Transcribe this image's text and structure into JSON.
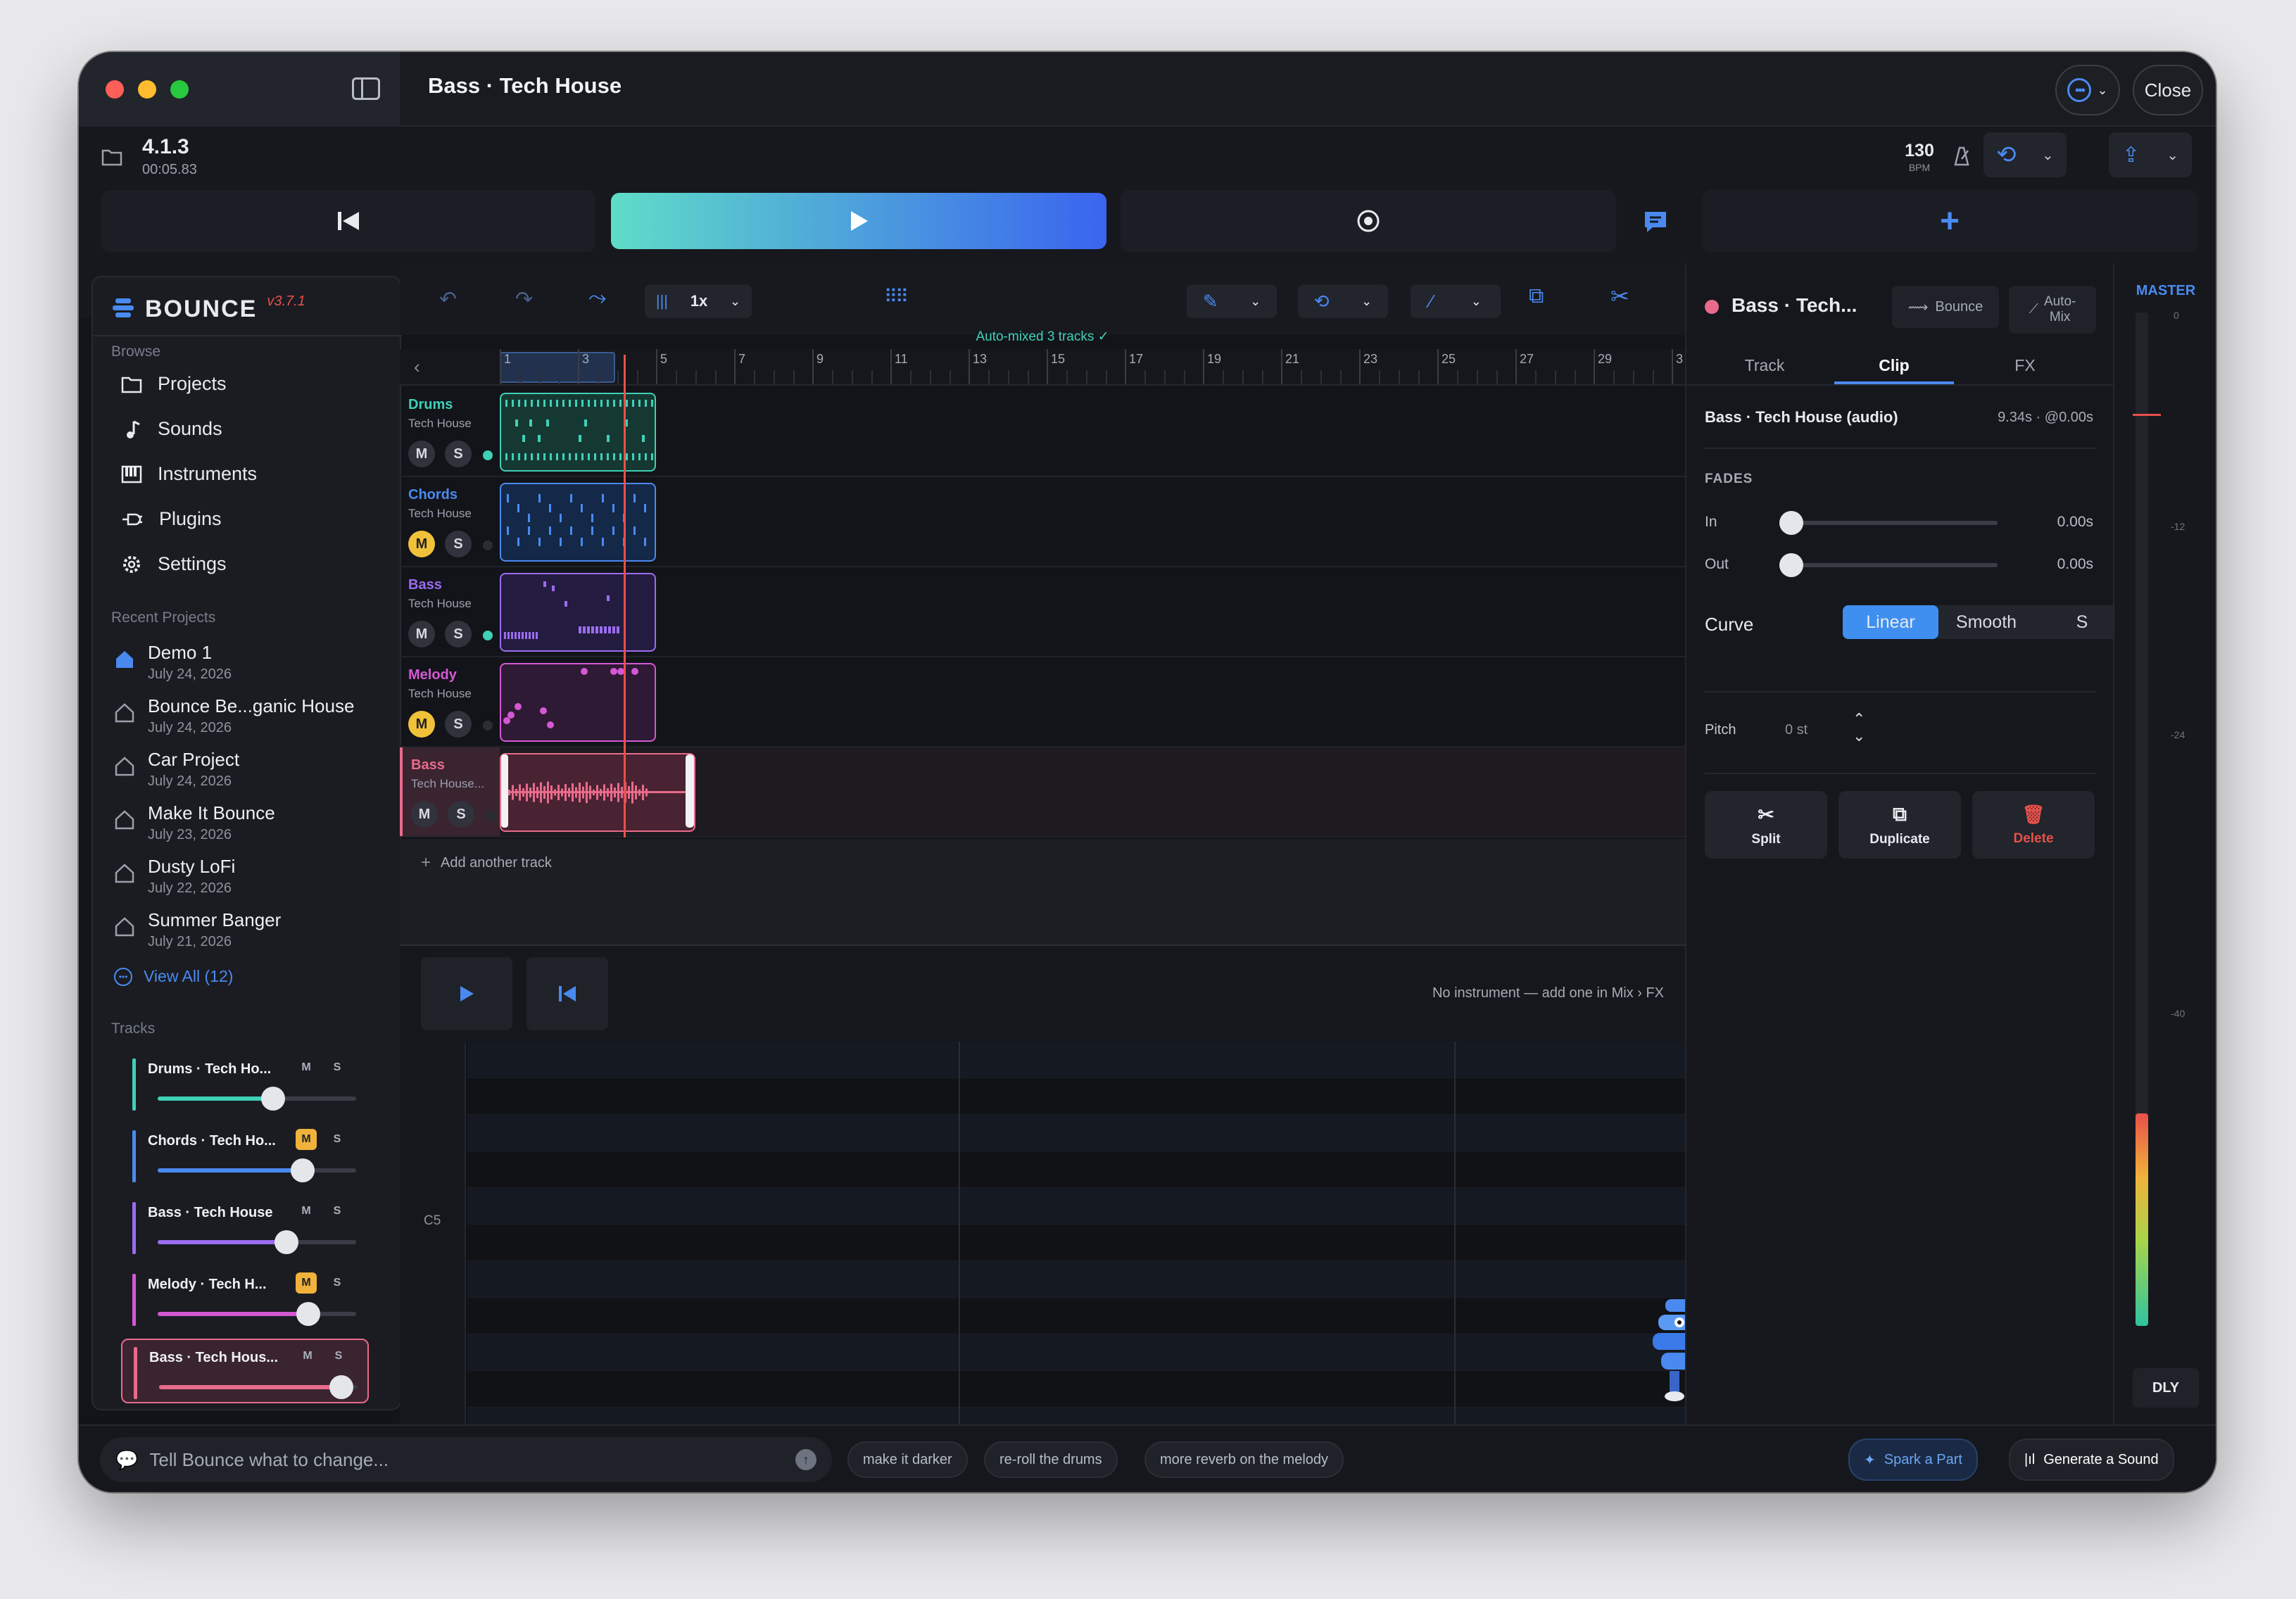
{
  "window": {
    "title": "Bass · Tech House",
    "close_label": "Close"
  },
  "position": {
    "bars": "4.1.3",
    "time": "00:05.83"
  },
  "tempo": {
    "value": "130",
    "unit": "BPM"
  },
  "toolbar": {
    "speed": "1x",
    "automix_status": "Auto-mixed 3 tracks ✓"
  },
  "ruler": {
    "marks": [
      "1",
      "3",
      "5",
      "7",
      "9",
      "11",
      "13",
      "15",
      "17",
      "19",
      "21",
      "23",
      "25",
      "27",
      "29",
      "3"
    ]
  },
  "sidebar": {
    "logo": "BOUNCE",
    "version": "v3.7.1",
    "browse_title": "Browse",
    "nav": [
      {
        "label": "Projects",
        "icon": "folder-icon"
      },
      {
        "label": "Sounds",
        "icon": "music-note-icon"
      },
      {
        "label": "Instruments",
        "icon": "piano-icon"
      },
      {
        "label": "Plugins",
        "icon": "plug-icon"
      },
      {
        "label": "Settings",
        "icon": "gear-icon"
      }
    ],
    "recent_title": "Recent Projects",
    "recent": [
      {
        "name": "Demo 1",
        "date": "July 24, 2026"
      },
      {
        "name": "Bounce Be...ganic House",
        "date": "July 24, 2026"
      },
      {
        "name": "Car Project",
        "date": "July 24, 2026"
      },
      {
        "name": "Make It Bounce",
        "date": "July 23, 2026"
      },
      {
        "name": "Dusty LoFi",
        "date": "July 22, 2026"
      },
      {
        "name": "Summer Banger",
        "date": "July 21, 2026"
      }
    ],
    "view_all": "View All (12)",
    "tracks_title": "Tracks",
    "tracks": [
      {
        "name": "Drums · Tech Ho...",
        "m": "M",
        "s": "S",
        "muted": false,
        "level": 0.58,
        "color": "#3fd0b8"
      },
      {
        "name": "Chords · Tech Ho...",
        "m": "M",
        "s": "S",
        "muted": true,
        "level": 0.73,
        "color": "#4a8af0"
      },
      {
        "name": "Bass · Tech House",
        "m": "M",
        "s": "S",
        "muted": false,
        "level": 0.65,
        "color": "#9b6cf0"
      },
      {
        "name": "Melody · Tech H...",
        "m": "M",
        "s": "S",
        "muted": true,
        "level": 0.76,
        "color": "#d458d4"
      },
      {
        "name": "Bass · Tech Hous...",
        "m": "M",
        "s": "S",
        "muted": false,
        "level": 0.92,
        "color": "#e86b8c"
      }
    ]
  },
  "lanes": [
    {
      "name": "Drums",
      "sub": "Tech House",
      "color": "#3fd0b8",
      "m": "M",
      "s": "S",
      "muted": false,
      "dot": "#3fd0b8"
    },
    {
      "name": "Chords",
      "sub": "Tech House",
      "color": "#4a8af0",
      "m": "M",
      "s": "S",
      "muted": true,
      "dot": ""
    },
    {
      "name": "Bass",
      "sub": "Tech House",
      "color": "#9b6cf0",
      "m": "M",
      "s": "S",
      "muted": false,
      "dot": "#3fd0b8"
    },
    {
      "name": "Melody",
      "sub": "Tech House",
      "color": "#d458d4",
      "m": "M",
      "s": "S",
      "muted": true,
      "dot": ""
    },
    {
      "name": "Bass",
      "sub": "Tech House...",
      "color": "#e86b8c",
      "m": "M",
      "s": "S",
      "muted": false,
      "dot": ""
    }
  ],
  "add_track": "Add another track",
  "piano_roll": {
    "message": "No instrument — add one in Mix › FX",
    "note_label": "C5"
  },
  "inspector": {
    "clip_title": "Bass · Tech...",
    "bounce_label": "Bounce",
    "automix_label": "Auto-\nMix",
    "tabs": [
      "Track",
      "Clip",
      "FX"
    ],
    "active_tab": "Clip",
    "clip_name": "Bass · Tech House (audio)",
    "clip_info": "9.34s · @0.00s",
    "fades_title": "FADES",
    "fade_in_label": "In",
    "fade_in_value": "0.00s",
    "fade_out_label": "Out",
    "fade_out_value": "0.00s",
    "curve_label": "Curve",
    "curve_options": [
      "Linear",
      "Smooth",
      "S"
    ],
    "curve_selected": "Linear",
    "pitch_label": "Pitch",
    "pitch_value": "0 st",
    "actions": [
      {
        "label": "Split",
        "icon": "scissors-icon"
      },
      {
        "label": "Duplicate",
        "icon": "duplicate-icon"
      },
      {
        "label": "Delete",
        "icon": "trash-icon"
      }
    ]
  },
  "master": {
    "title": "MASTER",
    "scale": [
      "0",
      "-12",
      "-24",
      "-40"
    ],
    "footer": "DLY",
    "level": 0.21
  },
  "prompt": {
    "placeholder": "Tell Bounce what to change...",
    "suggestions": [
      "make it darker",
      "re-roll the drums",
      "more reverb on the melody"
    ],
    "spark_label": "Spark a Part",
    "generate_label": "Generate a Sound"
  },
  "colors": {
    "accent": "#3f8ff0",
    "play_gradient_start": "#5fdcc8",
    "play_gradient_end": "#3a64f0",
    "playhead": "#e8504a"
  }
}
